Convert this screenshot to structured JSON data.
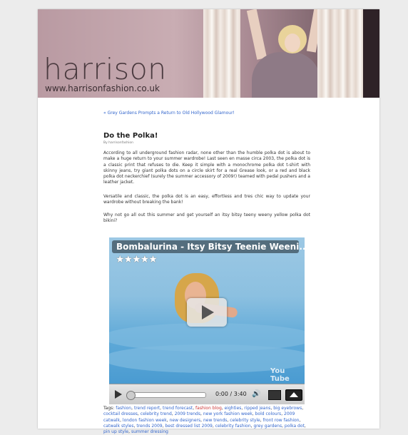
{
  "header": {
    "brand": "harrison",
    "url": "www.harrisonfashion.co.uk"
  },
  "nav": {
    "previous_post": "« Grey Gardens Prompts a Return to Old Hollywood Glamour!"
  },
  "post": {
    "title": "Do the Polka!",
    "byline": "By harrisonfashion",
    "paragraphs": [
      "According to all underground fashion radar, none other than the humble polka dot is about to make a huge return to your summer wardrobe! Last seen en masse circa 2003, the polka dot is a classic print that refuses to die. Keep it simple with a monochrome polka dot t-shirt with skinny jeans, try giant polka dots on a circle skirt for a real Grease look, or a red and black polka dot neckerchief (surely the summer accessory of 2009!) teamed with pedal pushers and a leather jacket.",
      "Versatile and classic, the polka dot is an easy, effortless and tres chic way to update your wardrobe without breaking the bank!",
      "Why not go all out this summer and get yourself an itsy bitsy teeny weeny yellow polka dot bikini?"
    ]
  },
  "video": {
    "title": "Bombalurina - Itsy Bitsy Teenie Weeni...",
    "stars": "★★★★★",
    "timecode": "0:00 / 3:40",
    "watermark": "You Tube",
    "progress": 0
  },
  "tags": {
    "label": "Tags:",
    "items": [
      "fashion",
      "trend report",
      "trend forecast",
      "fashion blog",
      "eighties",
      "ripped jeans",
      "big eyebrows",
      "cocktail dresses",
      "celebrity trend",
      "2009 trends",
      "new york fashion week",
      "bold colours",
      "2009 catwalk",
      "london fashion week",
      "new designers",
      "new trends",
      "celebrity style",
      "front row fashion",
      "catwalk styles",
      "trends 2009",
      "best dressed list 2009",
      "celebrity fashion",
      "grey gardens",
      "polka dot",
      "pin up style",
      "summer dressing"
    ],
    "highlighted": "fashion blog"
  }
}
